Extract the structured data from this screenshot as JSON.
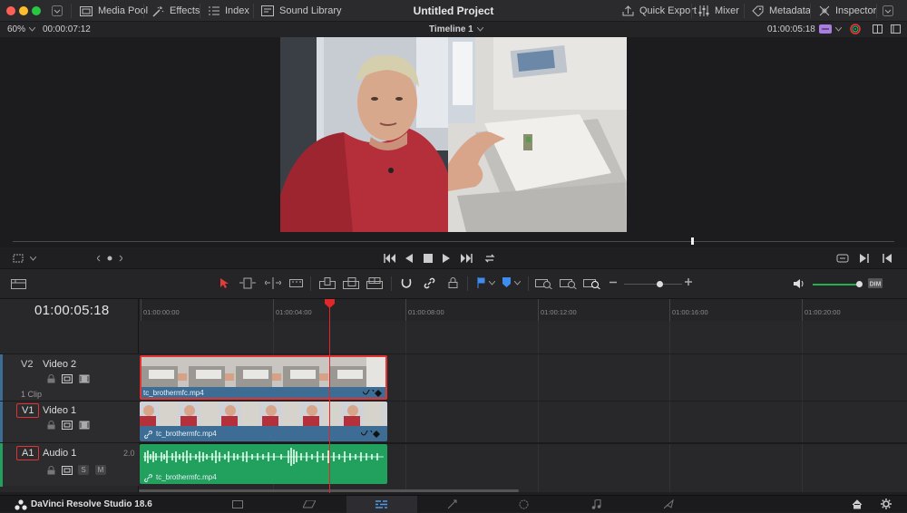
{
  "window": {
    "title": "Untitled Project"
  },
  "toolbar": {
    "media_pool": "Media Pool",
    "effects": "Effects",
    "index": "Index",
    "sound_library": "Sound Library",
    "quick_export": "Quick Export",
    "mixer": "Mixer",
    "metadata": "Metadata",
    "inspector": "Inspector"
  },
  "viewer": {
    "zoom": "60%",
    "source_timecode": "00:00:07:12",
    "timeline_name": "Timeline 1",
    "record_timecode": "01:00:05:18"
  },
  "timeline": {
    "current_timecode": "01:00:05:18",
    "ruler_labels": [
      "01:00:00:00",
      "01:00:04:00",
      "01:00:08:00",
      "01:00:12:00",
      "01:00:16:00",
      "01:00:20:00"
    ],
    "tracks": {
      "v2": {
        "id": "V2",
        "name": "Video 2",
        "clip_count": "1 Clip",
        "clip_name": "tc_brothermfc.mp4"
      },
      "v1": {
        "id": "V1",
        "name": "Video 1",
        "clip_name": "tc_brothermfc.mp4"
      },
      "a1": {
        "id": "A1",
        "name": "Audio 1",
        "channels": "2.0",
        "solo": "S",
        "mute": "M",
        "clip_name": "tc_brothermfc.mp4"
      }
    }
  },
  "footer": {
    "app_name": "DaVinci Resolve Studio 18.6"
  },
  "colors": {
    "playhead": "#e0282a",
    "video_clip": "#3d6d94",
    "audio_clip": "#21a05e",
    "selected_outline": "#e23232",
    "volume_slider": "#22b14c"
  }
}
